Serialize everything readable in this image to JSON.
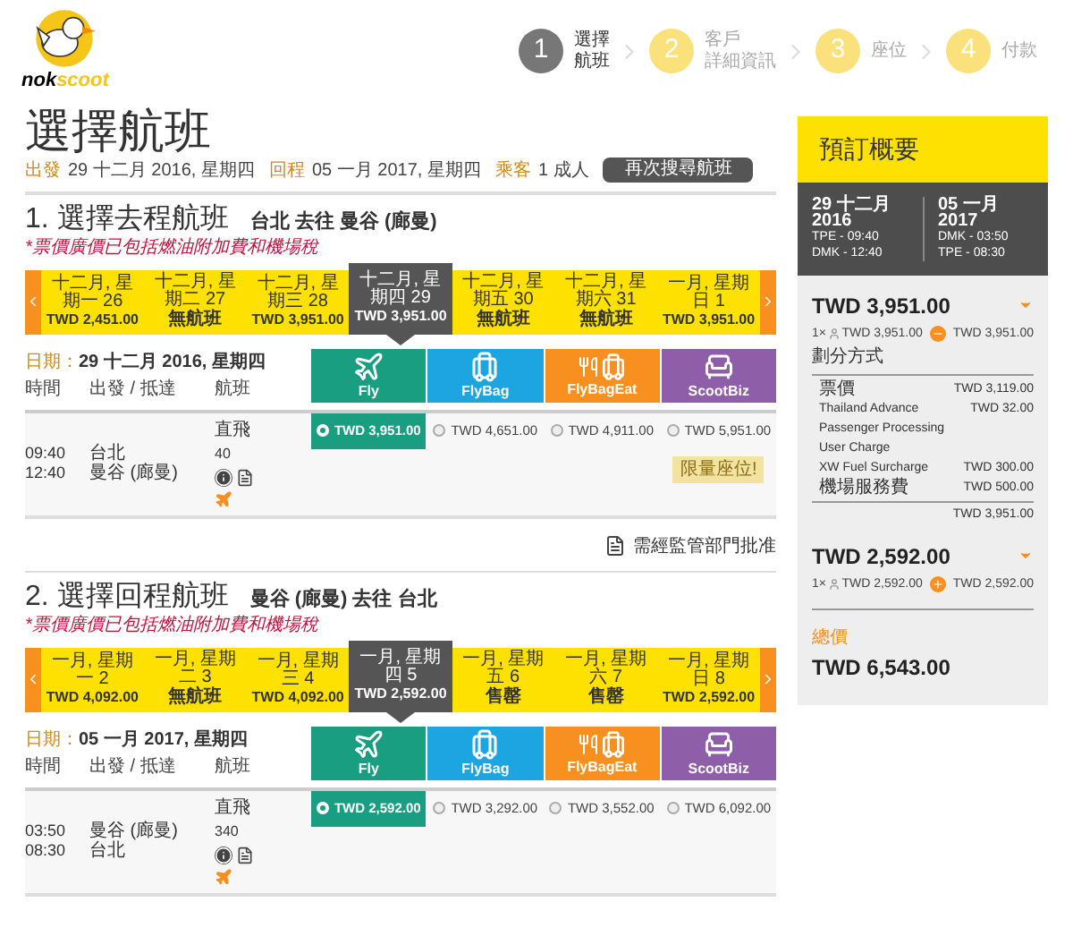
{
  "logo": {
    "brand": "nok",
    "sub": "scoot"
  },
  "steps": [
    {
      "number": "1",
      "lines": [
        "選擇",
        "航班"
      ],
      "selected": true
    },
    {
      "number": "2",
      "lines": [
        "客戶",
        "詳細資訊"
      ],
      "selected": false
    },
    {
      "number": "3",
      "lines": [
        "座位"
      ],
      "selected": false
    },
    {
      "number": "4",
      "lines": [
        "付款"
      ],
      "selected": false
    }
  ],
  "title": "選擇航班",
  "summary": [
    {
      "label": "出發",
      "value": "29 十二月 2016, 星期四"
    },
    {
      "label": "回程",
      "value": "05 一月 2017, 星期四"
    },
    {
      "label": "乘客",
      "value": "1 成人"
    }
  ],
  "search_again": "再次搜尋航班",
  "legs": [
    {
      "heading": "1. 選擇去程航班",
      "route": "台北 去往 曼谷 (廊曼)",
      "note": "*票價廣價已包括燃油附加費和機場稅",
      "dates": [
        {
          "label": "十二月, 星期一 26",
          "price": "TWD 2,451.00",
          "selected": false
        },
        {
          "label": "十二月, 星期二 27",
          "price": "無航班",
          "selected": false
        },
        {
          "label": "十二月, 星期三 28",
          "price": "TWD 3,951.00",
          "selected": false
        },
        {
          "label": "十二月, 星期四 29",
          "price": "TWD 3,951.00",
          "selected": true
        },
        {
          "label": "十二月, 星期五 30",
          "price": "無航班",
          "selected": false
        },
        {
          "label": "十二月, 星期六 31",
          "price": "無航班",
          "selected": false
        },
        {
          "label": "一月, 星期日 1",
          "price": "TWD 3,951.00",
          "selected": false
        }
      ],
      "date_label": "日期：",
      "date_value": "29 十二月 2016, 星期四",
      "columns": [
        "時間",
        "出發 / 抵達",
        "航班"
      ],
      "fares": [
        {
          "name": "Fly",
          "kind": "plane",
          "color": "#1a9e82",
          "price": "TWD 3,951.00",
          "selected": true
        },
        {
          "name": "FlyBag",
          "kind": "bag",
          "color": "#1ca5e0",
          "price": "TWD 4,651.00",
          "selected": false
        },
        {
          "name": "FlyBagEat",
          "kind": "bageat",
          "color": "#f7901e",
          "price": "TWD 4,911.00",
          "selected": false
        },
        {
          "name": "ScootBiz",
          "kind": "seat",
          "color": "#8e5ea8",
          "price": "TWD 5,951.00",
          "selected": false
        }
      ],
      "times": [
        "09:40",
        "12:40"
      ],
      "places": [
        "台北",
        "曼谷 (廊曼)"
      ],
      "flight_type": "直飛",
      "flight_number": "40",
      "badge": "限量座位!",
      "footer": "需經監管部門批准"
    },
    {
      "heading": "2. 選擇回程航班",
      "route": "曼谷 (廊曼) 去往 台北",
      "note": "*票價廣價已包括燃油附加費和機場稅",
      "dates": [
        {
          "label": "一月, 星期一 2",
          "price": "TWD 4,092.00",
          "selected": false
        },
        {
          "label": "一月, 星期二 3",
          "price": "無航班",
          "selected": false
        },
        {
          "label": "一月, 星期三 4",
          "price": "TWD 4,092.00",
          "selected": false
        },
        {
          "label": "一月, 星期四 5",
          "price": "TWD 2,592.00",
          "selected": true
        },
        {
          "label": "一月, 星期五 6",
          "price": "售罄",
          "selected": false
        },
        {
          "label": "一月, 星期六 7",
          "price": "售罄",
          "selected": false
        },
        {
          "label": "一月, 星期日 8",
          "price": "TWD 2,592.00",
          "selected": false
        }
      ],
      "date_label": "日期：",
      "date_value": "05 一月 2017, 星期四",
      "columns": [
        "時間",
        "出發 / 抵達",
        "航班"
      ],
      "fares": [
        {
          "name": "Fly",
          "kind": "plane",
          "color": "#1a9e82",
          "price": "TWD 2,592.00",
          "selected": true
        },
        {
          "name": "FlyBag",
          "kind": "bag",
          "color": "#1ca5e0",
          "price": "TWD 3,292.00",
          "selected": false
        },
        {
          "name": "FlyBagEat",
          "kind": "bageat",
          "color": "#f7901e",
          "price": "TWD 3,552.00",
          "selected": false
        },
        {
          "name": "ScootBiz",
          "kind": "seat",
          "color": "#8e5ea8",
          "price": "TWD 6,092.00",
          "selected": false
        }
      ],
      "times": [
        "03:50",
        "08:30"
      ],
      "places": [
        "曼谷 (廊曼)",
        "台北"
      ],
      "flight_type": "直飛",
      "flight_number": "340"
    }
  ],
  "booking": {
    "title": "預訂概要",
    "trips": [
      {
        "date": "29 十二月 2016",
        "from": "TPE - 09:40",
        "to": "DMK - 12:40"
      },
      {
        "date": "05 一月 2017",
        "from": "DMK - 03:50",
        "to": "TPE - 08:30"
      }
    ],
    "blocks": [
      {
        "total": "TWD 3,951.00",
        "count": "1×",
        "unit": "TWD 3,951.00",
        "sum": "TWD 3,951.00",
        "expanded": true,
        "breakdown_title": "劃分方式",
        "items": [
          {
            "label": "票價",
            "amount": "TWD 3,119.00"
          },
          {
            "label": "Thailand Advance Passenger Processing User Charge",
            "amount": "TWD 32.00"
          },
          {
            "label": "XW Fuel Surcharge",
            "amount": "TWD 300.00"
          },
          {
            "label": "機場服務費",
            "amount": "TWD 500.00"
          }
        ],
        "subtotal": "TWD 3,951.00"
      },
      {
        "total": "TWD 2,592.00",
        "count": "1×",
        "unit": "TWD 2,592.00",
        "sum": "TWD 2,592.00",
        "expanded": false
      }
    ],
    "grand_label": "總價",
    "grand_total": "TWD 6,543.00"
  }
}
